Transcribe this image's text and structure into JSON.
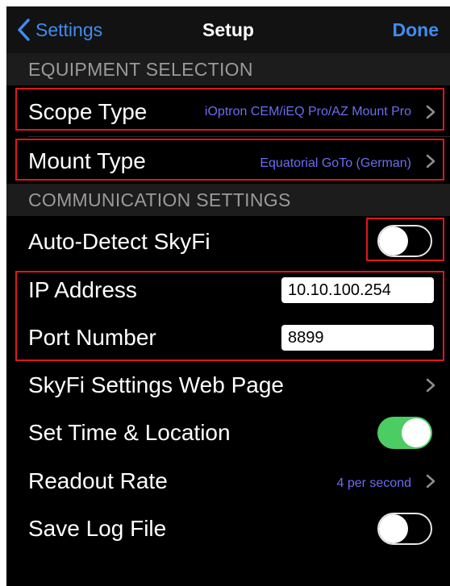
{
  "nav": {
    "back_label": "Settings",
    "title": "Setup",
    "done_label": "Done"
  },
  "sections": {
    "equipment": "EQUIPMENT SELECTION",
    "communication": "COMMUNICATION SETTINGS"
  },
  "rows": {
    "scope_type": {
      "label": "Scope Type",
      "value": "iOptron CEM/iEQ Pro/AZ Mount Pro"
    },
    "mount_type": {
      "label": "Mount Type",
      "value": "Equatorial GoTo (German)"
    },
    "auto_detect": {
      "label": "Auto-Detect SkyFi",
      "enabled": false
    },
    "ip_address": {
      "label": "IP Address",
      "value": "10.10.100.254"
    },
    "port_number": {
      "label": "Port Number",
      "value": "8899"
    },
    "web_page": {
      "label": "SkyFi Settings Web Page"
    },
    "set_time": {
      "label": "Set Time & Location",
      "enabled": true
    },
    "readout_rate": {
      "label": "Readout Rate",
      "value": "4 per second"
    },
    "save_log": {
      "label": "Save Log File",
      "enabled": false
    }
  },
  "colors": {
    "accent": "#3f8cf0",
    "value_text": "#6b6cf2",
    "toggle_on": "#4ccd63",
    "highlight": "#e0161e",
    "section_bg": "#1c1c1c",
    "section_text": "#9a9a9a"
  },
  "icons": {
    "back": "chevron-left-icon",
    "disclosure": "chevron-right-icon"
  }
}
